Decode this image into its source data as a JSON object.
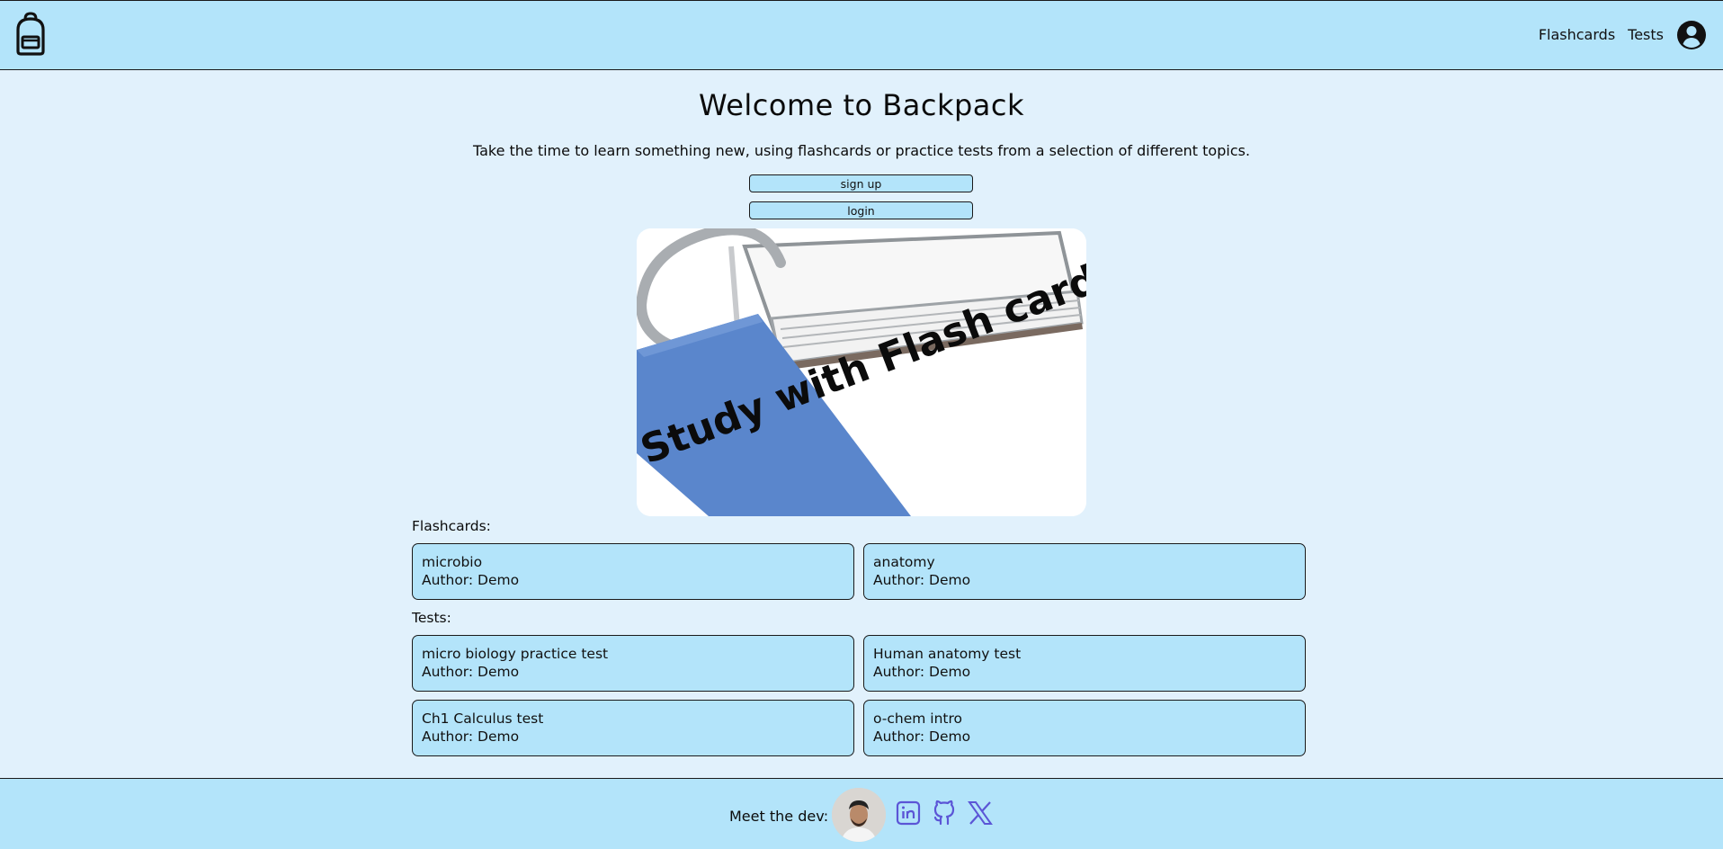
{
  "header": {
    "nav": {
      "flashcards": "Flashcards",
      "tests": "Tests"
    },
    "icons": {
      "logo": "backpack-icon",
      "account": "account-circle-icon"
    }
  },
  "main": {
    "title": "Welcome to Backpack",
    "subtitle": "Take the time to learn something new, using flashcards or practice tests from a selection of different topics.",
    "signup_label": "sign up",
    "login_label": "login",
    "banner_text": "Study with Flash cards!",
    "flashcards_label": "Flashcards:",
    "flashcards": [
      {
        "title": "microbio",
        "author": "Author: Demo"
      },
      {
        "title": "anatomy",
        "author": "Author: Demo"
      }
    ],
    "tests_label": "Tests:",
    "tests": [
      {
        "title": "micro biology practice test",
        "author": "Author: Demo"
      },
      {
        "title": "Human anatomy test",
        "author": "Author: Demo"
      },
      {
        "title": "Ch1 Calculus test",
        "author": "Author: Demo"
      },
      {
        "title": "o-chem intro",
        "author": "Author: Demo"
      }
    ]
  },
  "footer": {
    "label": "Meet the dev:",
    "icons": [
      "linkedin-icon",
      "github-icon",
      "x-icon"
    ]
  },
  "colors": {
    "background": "#e1f1fc",
    "header_bg": "#b3e4fa",
    "card_bg": "#b3e4fa",
    "social_icon": "#5b55d6",
    "banner_card_blue": "#5a86cc"
  }
}
